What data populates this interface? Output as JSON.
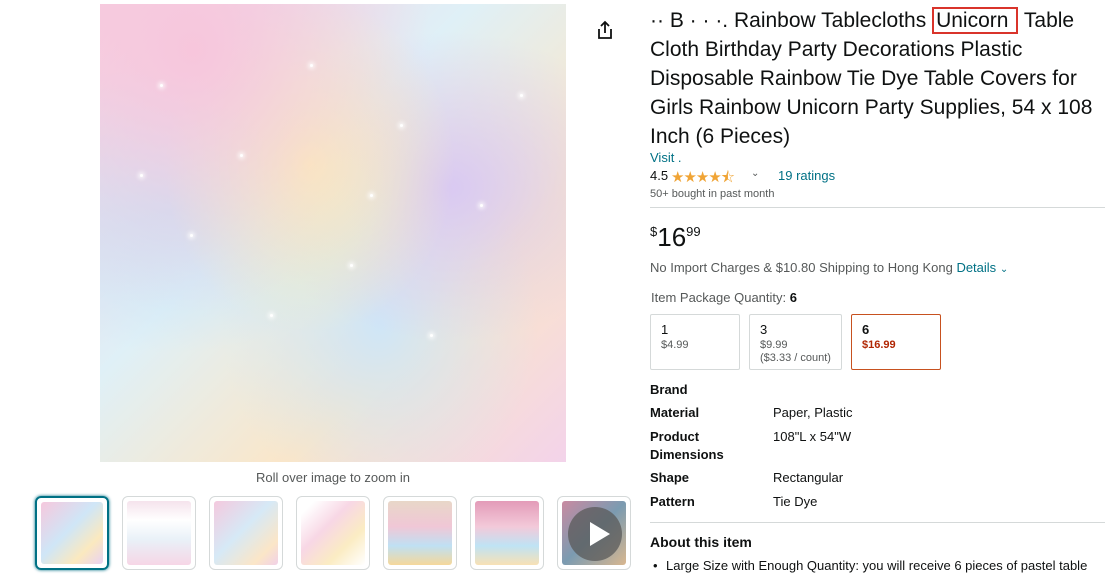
{
  "gallery": {
    "zoom_hint": "Roll over image to zoom in",
    "share_icon": "share-icon",
    "play_icon": "play-icon"
  },
  "product": {
    "title_main": "·· B · · ·. Rainbow Tablecloths",
    "title_highlight": "Unicorn",
    "title_rest": "Table Cloth Birthday Party Decorations Plastic Disposable Rainbow Tie Dye Table Covers for Girls Rainbow Unicorn Party Supplies, 54 x 108 Inch (6 Pieces)",
    "visit_link": "Visit .",
    "rating_value": "4.5",
    "stars": "★★★★⯪",
    "ratings_count": "19 ratings",
    "bought": "50+ bought in past month",
    "price_symbol": "$",
    "price_whole": "16",
    "price_fraction": "99",
    "shipping": "No Import Charges & $10.80 Shipping to Hong Kong",
    "details_link": "Details",
    "qty_label": "Item Package Quantity:",
    "qty_selected": "6",
    "qty_options": [
      {
        "num": "1",
        "price": "$4.99",
        "unit": ""
      },
      {
        "num": "3",
        "price": "$9.99",
        "unit": "($3.33 / count)"
      },
      {
        "num": "6",
        "price": "$16.99",
        "unit": ""
      }
    ],
    "specs": [
      {
        "key": "Brand",
        "value": ""
      },
      {
        "key": "Material",
        "value": "Paper, Plastic"
      },
      {
        "key": "Product Dimensions",
        "value": "108\"L x 54\"W"
      },
      {
        "key": "Shape",
        "value": "Rectangular"
      },
      {
        "key": "Pattern",
        "value": "Tie Dye"
      }
    ],
    "about_title": "About this item",
    "about_bullet": "Large Size with Enough Quantity: you will receive 6 pieces of pastel table"
  },
  "colors": {
    "link": "#007185",
    "price_red": "#b12704",
    "highlight_border": "#d9342b",
    "star": "#f0a435"
  }
}
